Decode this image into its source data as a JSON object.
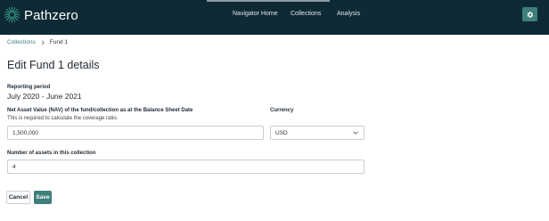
{
  "header": {
    "brand": "Pathzero",
    "nav": [
      "Navigator Home",
      "Collections",
      "Analysis"
    ]
  },
  "breadcrumb": {
    "parent": "Collections",
    "current": "Fund 1"
  },
  "page": {
    "title": "Edit Fund 1 details"
  },
  "reporting": {
    "label": "Reporting period",
    "value": "July 2020 - June 2021"
  },
  "nav_field": {
    "label": "Net Asset Value (NAV) of the fund/collection as at the Balance Sheet Date",
    "help": "This is required to calculate the coverage ratio.",
    "value": "1,500,000"
  },
  "currency": {
    "label": "Currency",
    "selected": "USD"
  },
  "assets": {
    "label": "Number of assets in this collection",
    "value": "4"
  },
  "actions": {
    "cancel": "Cancel",
    "save": "Save"
  },
  "colors": {
    "topbar": "#0e2a35",
    "accent": "#3e7f7a",
    "link": "#3d7f8b"
  },
  "icons": {
    "logo": "pathzero-sunburst-logo",
    "settings": "gear-icon",
    "breadcrumb_separator": "chevron-right-icon",
    "select": "chevron-down-icon"
  }
}
